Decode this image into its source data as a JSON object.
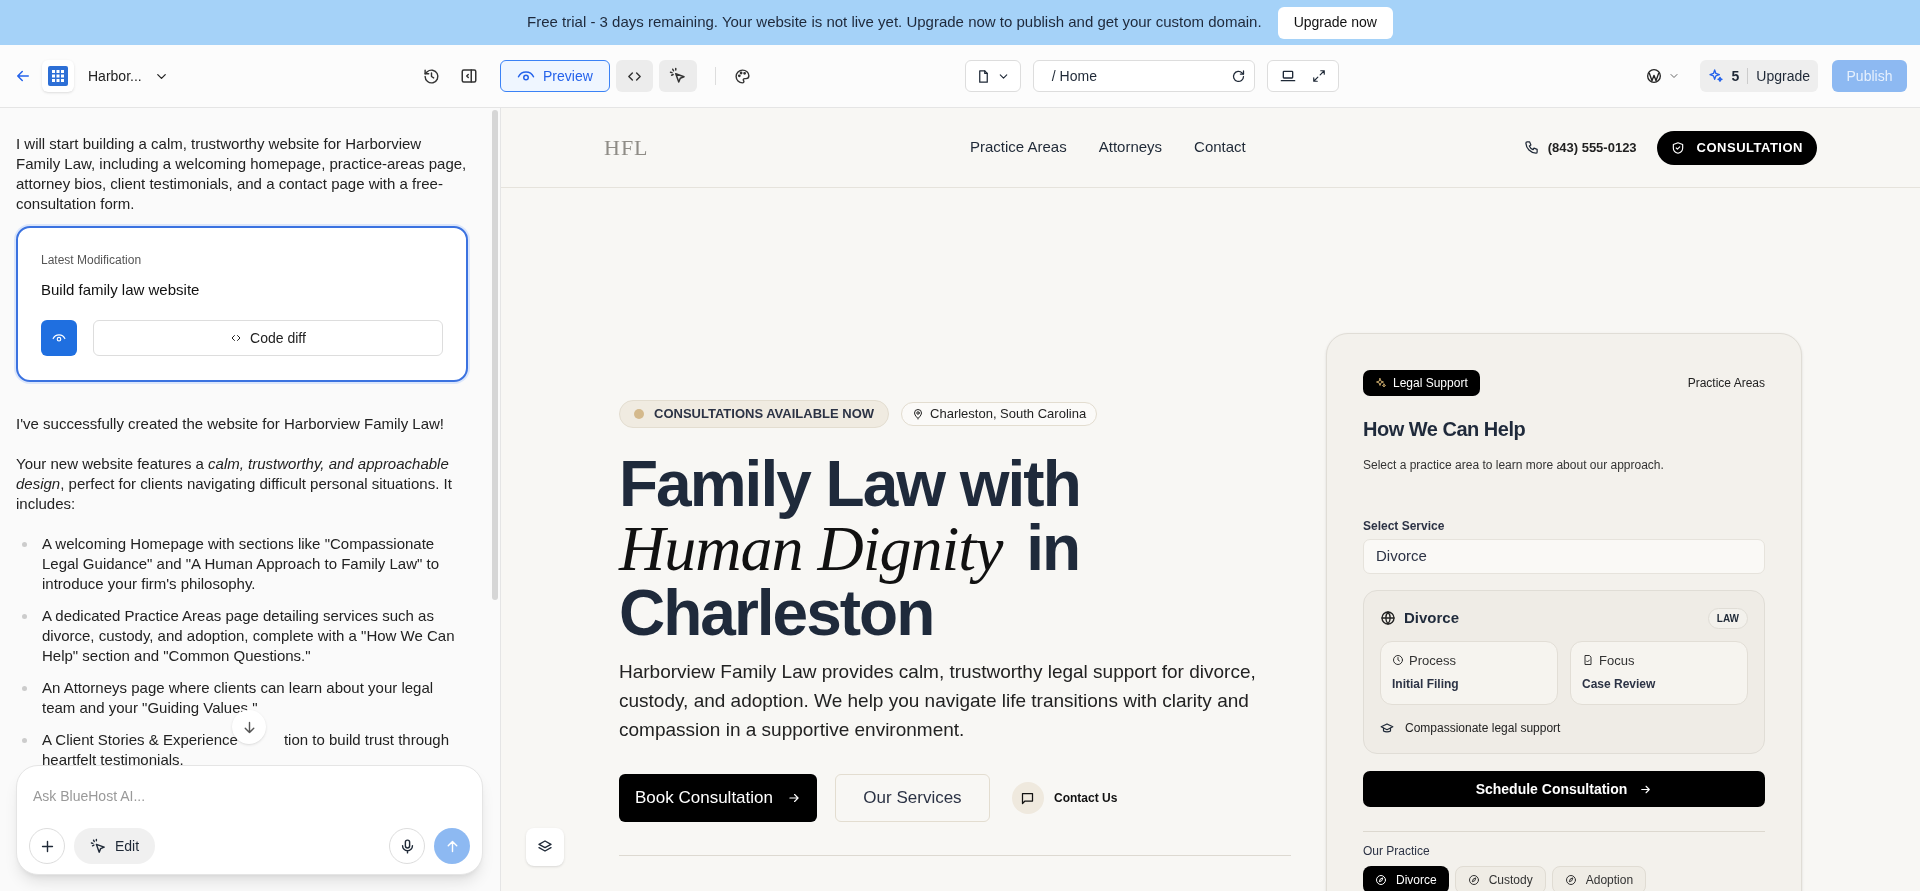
{
  "banner": {
    "text": "Free trial - 3 days remaining. Your website is not live yet. Upgrade now to publish and get your custom domain.",
    "button": "Upgrade now"
  },
  "toolbar": {
    "project": "Harbor...",
    "view_modes": [
      {
        "kind": "preview",
        "label": "Preview",
        "selected": true
      },
      {
        "kind": "code",
        "selected": false
      },
      {
        "kind": "select",
        "selected": false
      }
    ],
    "address": "/ Home",
    "credits": "5",
    "upgrade": "Upgrade",
    "publish": {
      "label": "Publish",
      "disabled": true
    }
  },
  "chat": {
    "intro": "I will start building a calm, trustworthy website for Harborview Family Law, including a welcoming homepage, practice-areas page, attorney bios, client testimonials, and a contact page with a free-consultation form.",
    "modification": {
      "caption": "Latest Modification",
      "title": "Build family law website",
      "code_diff": "Code diff"
    },
    "paragraphs": [
      "I've successfully created the website for Harborview Family Law!",
      "Your new website features a *calm, trustworthy, and approachable design*, perfect for clients navigating difficult personal situations. It includes:"
    ],
    "list": [
      "A welcoming Homepage with sections like \"Compassionate Legal Guidance\" and \"A Human Approach to Family Law\" to introduce your firm's philosophy.",
      "A dedicated Practice Areas page detailing services such as divorce, custody, and adoption, complete with a \"How We Can Help\" section and \"Common Questions.\"",
      "An Attorneys page where clients can learn about your legal team and your \"Guiding Values.\"",
      "A Client Stories & Experience"
    ],
    "covered_item_rest": [
      "tion to build trust through",
      "heartfelt testimonials."
    ],
    "input": {
      "placeholder": "Ask BlueHost AI...",
      "edit": "Edit"
    }
  },
  "site": {
    "logo": "HFL",
    "nav": [
      "Practice Areas",
      "Attorneys",
      "Contact"
    ],
    "phone": "(843) 555-0123",
    "cta": "CONSULTATION",
    "hero": {
      "badge": "CONSULTATIONS AVAILABLE NOW",
      "location": "Charleston, South Carolina",
      "heading_lines": [
        "Family Law with",
        "*Human Dignity* in",
        "Charleston"
      ],
      "text": "Harborview Family Law provides calm, trustworthy legal support for divorce, custody, and adoption. We help you navigate life transitions with clarity and compassion in a supportive environment.",
      "primary": "Book Consultation",
      "secondary": "Our Services",
      "contact": "Contact Us"
    },
    "card": {
      "tag": "Legal Support",
      "link": "Practice Areas",
      "title": "How We Can Help",
      "subtitle": "Select a practice area to learn more about our approach.",
      "select_label": "Select Service",
      "select_value": "Divorce",
      "service": {
        "name": "Divorce",
        "badge": "LAW",
        "details": [
          {
            "kind": "process",
            "label": "Process",
            "value": "Initial Filing"
          },
          {
            "kind": "focus",
            "label": "Focus",
            "value": "Case Review"
          }
        ],
        "note": "Compassionate legal support"
      },
      "button": "Schedule Consultation",
      "practice_label": "Our Practice",
      "chips": [
        {
          "label": "Divorce",
          "selected": true
        },
        {
          "label": "Custody",
          "selected": false
        },
        {
          "label": "Adoption",
          "selected": false
        }
      ]
    }
  }
}
